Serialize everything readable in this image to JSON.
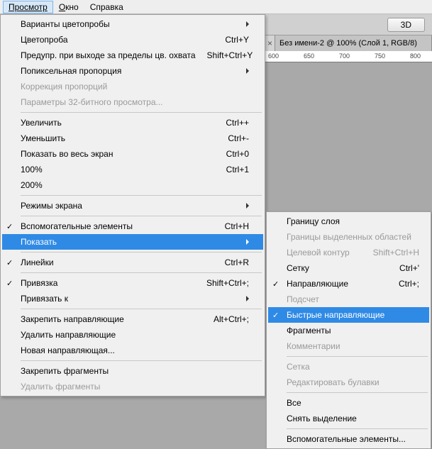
{
  "menubar": {
    "view": "Просмотр",
    "window": "Окно",
    "help": "Справка"
  },
  "toolbar": {
    "btn3d": "3D"
  },
  "tabs": {
    "tab2_title": "Без имени-2 @ 100% (Слой 1, RGB/8)"
  },
  "ruler": [
    "600",
    "650",
    "700",
    "750",
    "800"
  ],
  "menu": {
    "variant_proof": "Варианты цветопробы",
    "proof": "Цветопроба",
    "proof_sc": "Ctrl+Y",
    "gamut": "Предупр. при выходе за пределы цв. охвата",
    "gamut_sc": "Shift+Ctrl+Y",
    "pixel_aspect": "Попиксельная пропорция",
    "proportion_corr": "Коррекция пропорций",
    "params32": "Параметры 32-битного просмотра...",
    "zoom_in": "Увеличить",
    "zoom_in_sc": "Ctrl++",
    "zoom_out": "Уменьшить",
    "zoom_out_sc": "Ctrl+-",
    "fullscreen": "Показать во весь экран",
    "fullscreen_sc": "Ctrl+0",
    "pct100": "100%",
    "pct100_sc": "Ctrl+1",
    "pct200": "200%",
    "screen_modes": "Режимы экрана",
    "extras": "Вспомогательные элементы",
    "extras_sc": "Ctrl+H",
    "show": "Показать",
    "rulers": "Линейки",
    "rulers_sc": "Ctrl+R",
    "snap": "Привязка",
    "snap_sc": "Shift+Ctrl+;",
    "snap_to": "Привязать к",
    "lock_guides": "Закрепить направляющие",
    "lock_guides_sc": "Alt+Ctrl+;",
    "clear_guides": "Удалить направляющие",
    "new_guide": "Новая направляющая...",
    "lock_slices": "Закрепить фрагменты",
    "clear_slices": "Удалить фрагменты"
  },
  "submenu": {
    "layer_edges": "Границу слоя",
    "selection_edges": "Границы выделенных областей",
    "target_path": "Целевой контур",
    "target_path_sc": "Shift+Ctrl+H",
    "grid": "Сетку",
    "grid_sc": "Ctrl+'",
    "guides": "Направляющие",
    "guides_sc": "Ctrl+;",
    "count": "Подсчет",
    "smart_guides": "Быстрые направляющие",
    "slices": "Фрагменты",
    "notes": "Комментарии",
    "grid2": "Сетка",
    "edit_pins": "Редактировать булавки",
    "all": "Все",
    "none": "Снять выделение",
    "ext_elements": "Вспомогательные элементы..."
  }
}
